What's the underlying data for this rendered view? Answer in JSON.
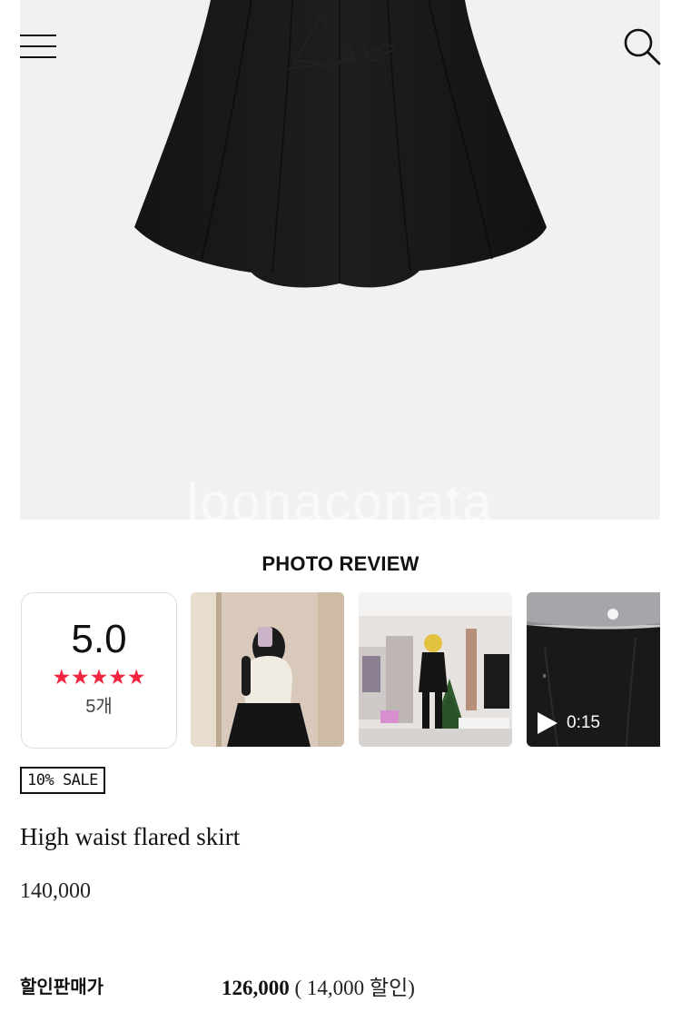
{
  "header": {
    "brand_logo": "Loar",
    "menu_icon": "hamburger-menu-icon",
    "search_icon": "search-icon"
  },
  "hero": {
    "watermark": "loonaconata"
  },
  "photo_review": {
    "title": "PHOTO REVIEW",
    "rating": {
      "score": "5.0",
      "stars": "★★★★★",
      "star_count": 5,
      "star_color": "#f2243f",
      "count": "5개"
    },
    "thumbnails": [
      {
        "kind": "photo"
      },
      {
        "kind": "photo"
      },
      {
        "kind": "video",
        "duration": "0:15",
        "icon": "play-icon"
      }
    ]
  },
  "product": {
    "badge": "10% SALE",
    "name": "High waist flared skirt",
    "price": "140,000",
    "sale_label": "할인판매가",
    "sale_price": "126,000",
    "discount_text": "( 14,000 할인)"
  }
}
